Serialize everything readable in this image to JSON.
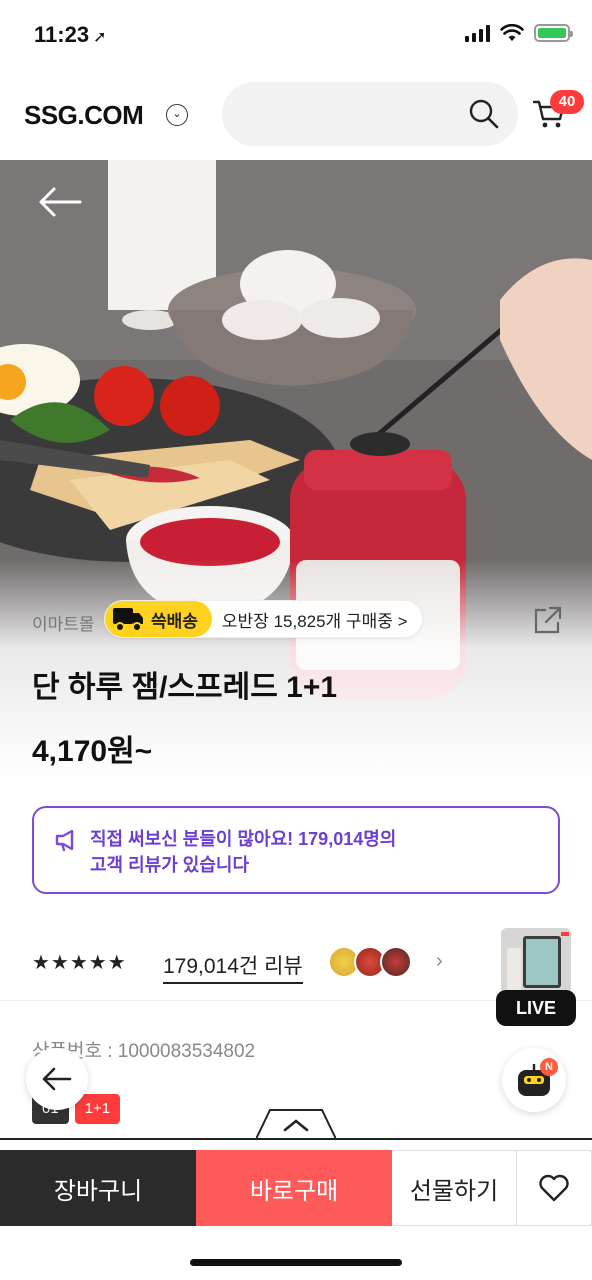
{
  "status_bar": {
    "time": "11:23"
  },
  "header": {
    "logo": "SSG.COM",
    "search_placeholder": "",
    "cart_count": "40"
  },
  "product": {
    "mall": "이마트몰",
    "delivery_tag": "쓱배송",
    "buying_text": "오반장 15,825개 구매중",
    "buying_chevron": ">",
    "title": "단 하루 잼/스프레드 1+1",
    "price": "4,170원~",
    "notice_line1": "직접 써보신 분들이 많아요! 179,014명의",
    "notice_line2": "고객 리뷰가 있습니다",
    "stars": "★★★★★",
    "review_count": "179,014건 리뷰",
    "review_chevron": "›",
    "product_number": "상품번호 : 1000083534802",
    "option_tags": [
      "01",
      "1+1"
    ]
  },
  "live": {
    "label": "LIVE"
  },
  "bot": {
    "badge": "N"
  },
  "bottom_bar": {
    "cart": "장바구니",
    "buy": "바로구매",
    "gift": "선물하기"
  },
  "colors": {
    "accent_purple": "#7a4cd9",
    "buy_red": "#ff5a5a",
    "delivery_yellow": "#ffd21f",
    "badge_red": "#ff3b3b"
  }
}
